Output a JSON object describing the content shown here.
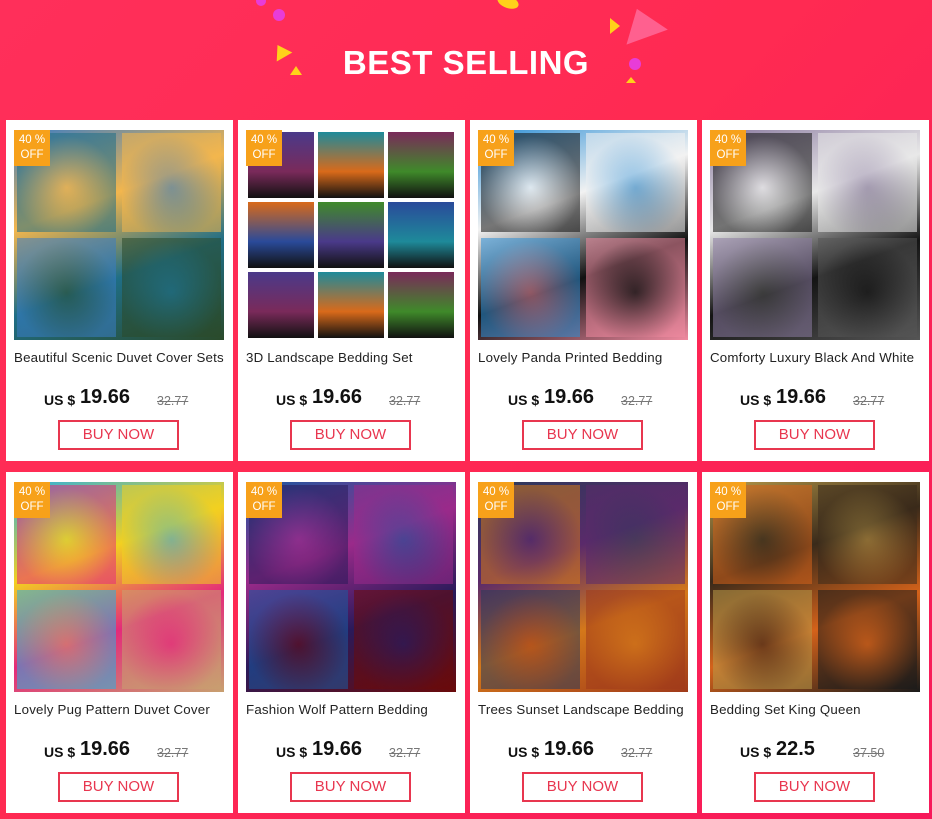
{
  "header": {
    "title": "BEST SELLING"
  },
  "products": [
    {
      "name": "Beautiful Scenic Duvet Cover Sets",
      "badge_line1": "40 %",
      "badge_line2": "OFF",
      "currency": "US $",
      "price": "19.66",
      "old_price": "32.77",
      "buy_label": "BUY NOW",
      "colors": [
        "#1f6e86",
        "#f3b64d",
        "#3a7cc4",
        "#2a4a2a"
      ]
    },
    {
      "name": "3D Landscape Bedding Set",
      "badge_line1": "40 %",
      "badge_line2": "OFF",
      "currency": "US $",
      "price": "19.66",
      "old_price": "32.77",
      "buy_label": "BUY NOW",
      "colors": [
        "#4a3a8a",
        "#1e8a9a",
        "#7a2a5a",
        "#d96a1a",
        "#3f8a2a",
        "#2a4a9a"
      ]
    },
    {
      "name": "Lovely Panda Printed Bedding",
      "badge_line1": "40 %",
      "badge_line2": "OFF",
      "currency": "US $",
      "price": "19.66",
      "old_price": "32.77",
      "buy_label": "BUY NOW",
      "colors": [
        "#111111",
        "#f2f2f2",
        "#2d8fd6",
        "#f08aa0"
      ]
    },
    {
      "name": "Comforty Luxury Black And White",
      "badge_line1": "40 %",
      "badge_line2": "OFF",
      "currency": "US $",
      "price": "19.66",
      "old_price": "32.77",
      "buy_label": "BUY NOW",
      "colors": [
        "#141414",
        "#e8e8e8",
        "#8a7aa0",
        "#555555"
      ]
    },
    {
      "name": "Lovely Pug Pattern Duvet Cover",
      "badge_line1": "40 %",
      "badge_line2": "OFF",
      "currency": "US $",
      "price": "19.66",
      "old_price": "32.77",
      "buy_label": "BUY NOW",
      "colors": [
        "#e42a7a",
        "#f2d020",
        "#2ab0e0",
        "#c8a070"
      ]
    },
    {
      "name": "Fashion Wolf Pattern Bedding",
      "badge_line1": "40 %",
      "badge_line2": "OFF",
      "currency": "US $",
      "price": "19.66",
      "old_price": "32.77",
      "buy_label": "BUY NOW",
      "colors": [
        "#2a1a5a",
        "#9a2a8a",
        "#1a5aa0",
        "#6a0a0a"
      ]
    },
    {
      "name": "Trees Sunset Landscape Bedding",
      "badge_line1": "40 %",
      "badge_line2": "OFF",
      "currency": "US $",
      "price": "19.66",
      "old_price": "32.77",
      "buy_label": "BUY NOW",
      "colors": [
        "#d4781a",
        "#5a2a6a",
        "#2a3a5a",
        "#a03a1a"
      ]
    },
    {
      "name": "Bedding Set King Queen",
      "badge_line1": "40 %",
      "badge_line2": "OFF",
      "currency": "US $",
      "price": "22.5",
      "old_price": "37.50",
      "buy_label": "BUY NOW",
      "colors": [
        "#d4621a",
        "#3a2a1a",
        "#b89a4a",
        "#1a1a1a"
      ]
    }
  ],
  "accent": "#ff2f5a",
  "badge_color": "#f7a11a"
}
